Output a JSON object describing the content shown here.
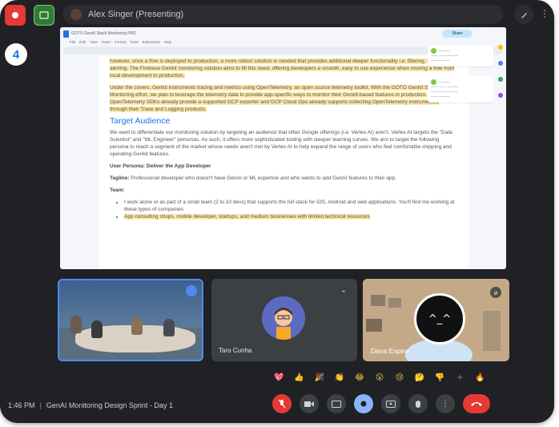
{
  "header": {
    "presenter_title": "Alex Singer (Presenting)"
  },
  "left_rail": {
    "avatar_letter": "4"
  },
  "document": {
    "file_title": "GOTO GenAI Stack Monitoring PRD",
    "menu": [
      "File",
      "Edit",
      "View",
      "Insert",
      "Format",
      "Tools",
      "Extensions",
      "Help"
    ],
    "share_label": "Share",
    "para1": "however, once a flow is deployed to production, a more robust solution is needed that provides additional deeper functionality i.e. filtering, trends, alerting. The Firebase Genkit monitoring solution aims to fill this need, offering developers a smooth, easy to use experience when moving a flow from local development to production.",
    "para2": "Under the covers, Genkit instruments tracing and metrics using OpenTelemetry, an open source telemetry toolkit. With the GOTO Genkit Stack Monitoring effort, we plan to leverage the telemetry data to provide app-specific ways to monitor their Genkit-based features in production. OpenTelemetry SDKs already provide a supported GCP exporter and GCP Cloud Ops already supports collecting OpenTelemetry instrumented through their Trace and Logging products.",
    "heading": "Target Audience",
    "para3": "We want to differentiate our monitoring solution by targeting an audience that other Google offerings (i.e. Vertex AI) aren't. Vertex AI targets the \"Data Scientist\" and \"ML Engineer\" personas. As such, it offers more sophisticated tooling with steeper learning curves. We aim to target the following persona to reach a segment of the market whose needs aren't met by Vertex AI to help expand the range of users who feel comfortable shipping and operating Genkit features.",
    "persona_label": "User Persona: Deliver the App Developer",
    "tagline_label": "Tagline:",
    "tagline": "Professional developer who doesn't have GenAI or ML expertise and who wants to add GenAI features to their app.",
    "team_label": "Team:",
    "bullet1": "I work alone or as part of a small team (2 to 10 devs) that supports the full stack for iOS, Android and web applications. You'll find me working at these types of companies:",
    "bullet2": "App consulting shops, mobile developer, startups, and medium businesses with limited technical resources"
  },
  "tiles": [
    {
      "name": "Conference room"
    },
    {
      "name": "Taro Cunha"
    },
    {
      "name": "Dana Espine"
    }
  ],
  "reactions": [
    "💖",
    "👍",
    "🎉",
    "👏",
    "😂",
    "😮",
    "😢",
    "🤔",
    "👎",
    "+",
    "🔥"
  ],
  "footer": {
    "time": "1:46 PM",
    "meeting_title": "GenAI Monitoring Design Sprint - Day 1"
  },
  "colors": {
    "accent": "#4c8bf5",
    "record": "#e53935",
    "doc_heading": "#1a73e8",
    "highlight": "#fde8a8"
  }
}
